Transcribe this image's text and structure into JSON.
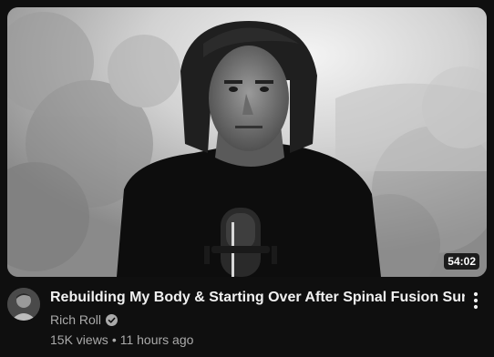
{
  "video": {
    "title": "Rebuilding My Body & Starting Over After Spinal Fusion Surgery",
    "duration": "54:02",
    "channel": "Rich Roll",
    "verified": true,
    "views": "15K views",
    "separator": "•",
    "published": "11 hours ago"
  },
  "icons": {
    "verified": "verified-check-icon",
    "menu": "more-vert-icon"
  },
  "colors": {
    "background": "#0f0f0f",
    "title": "#f1f1f1",
    "secondary": "#aaaaaa",
    "badge_bg": "#000000"
  }
}
